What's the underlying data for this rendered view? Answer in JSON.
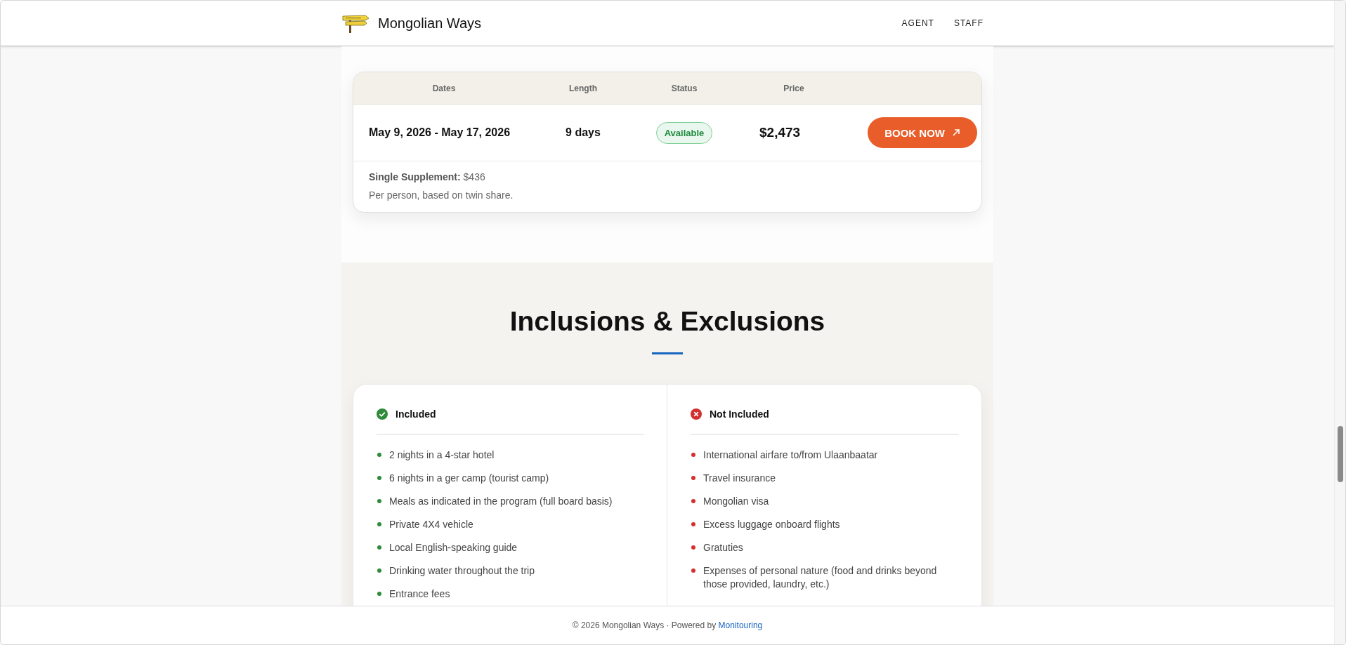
{
  "header": {
    "title": "Mongolian Ways",
    "nav": [
      {
        "label": "AGENT"
      },
      {
        "label": "STAFF"
      }
    ]
  },
  "departures": {
    "columns": [
      "Dates",
      "Length",
      "Status",
      "Price"
    ],
    "rows": [
      {
        "dates": "May 9, 2026 - May 17, 2026",
        "length": "9 days",
        "status": "Available",
        "kind": "available",
        "price": "$2,473",
        "action": "BOOK NOW"
      }
    ],
    "supplement": "**Single Supplement:** $436",
    "note": "Per person, based on twin share."
  },
  "inclusions": {
    "title": "Inclusions & Exclusions",
    "lists": [
      {
        "kind": "included",
        "heading": "Included",
        "items": [
          "2 nights in a 4-star hotel",
          "6 nights in a ger camp (tourist camp)",
          "Meals as indicated in the program (full board basis)",
          "Private 4X4 vehicle",
          "Local English-speaking guide",
          "Drinking water throughout the trip",
          "Entrance fees"
        ]
      },
      {
        "kind": "excluded",
        "heading": "Not Included",
        "items": [
          "International airfare to/from Ulaanbaatar",
          "Travel insurance",
          "Mongolian visa",
          "Excess luggage onboard flights",
          "Gratuties",
          "Expenses of personal nature (food and drinks beyond those provided, laundry, etc.)"
        ]
      }
    ]
  },
  "footer": {
    "text": "© 2026 Mongolian Ways · Powered by",
    "link": "Monitouring"
  }
}
